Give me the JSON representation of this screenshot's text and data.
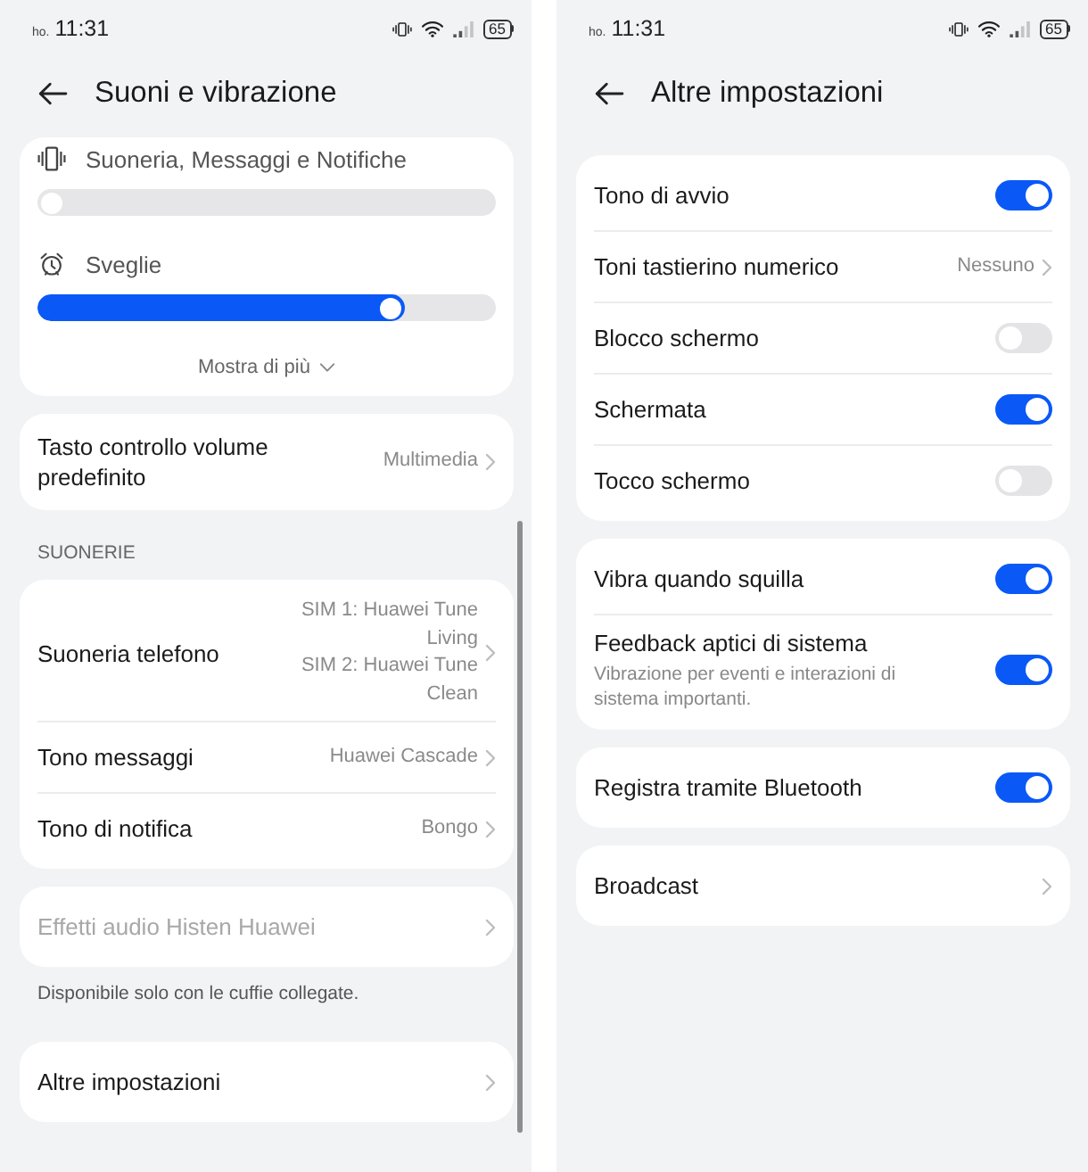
{
  "screens": [
    {
      "status_bar": {
        "carrier": "ho.",
        "time": "11:31",
        "battery": "65"
      },
      "title": "Suoni e vibrazione",
      "scrolled": true,
      "groups": [
        {
          "kind": "card",
          "rows": [
            {
              "kind": "slider",
              "label": "Suoneria, Messaggi e Notifiche",
              "level": 0
            },
            {
              "kind": "slider",
              "label": "Sveglie",
              "level": 0.8
            },
            {
              "kind": "more",
              "label": "Mostra di più"
            }
          ]
        },
        {
          "kind": "card",
          "rows": [
            {
              "kind": "nav",
              "label": "Tasto controllo volume predefinito",
              "values": [
                "Multimedia"
              ],
              "disabled": false
            }
          ]
        },
        {
          "kind": "header",
          "label": "SUONERIE"
        },
        {
          "kind": "card",
          "rows": [
            {
              "kind": "nav",
              "label": "Suoneria telefono",
              "values": [
                "SIM 1: Huawei Tune Living",
                "SIM 2: Huawei Tune Clean"
              ],
              "disabled": false
            },
            {
              "kind": "nav",
              "label": "Tono messaggi",
              "values": [
                "Huawei Cascade"
              ],
              "disabled": false
            },
            {
              "kind": "nav",
              "label": "Tono di notifica",
              "values": [
                "Bongo"
              ],
              "disabled": false
            }
          ]
        },
        {
          "kind": "card",
          "rows": [
            {
              "kind": "nav",
              "label": "Effetti audio Histen Huawei",
              "disabled": true
            }
          ]
        },
        {
          "kind": "note",
          "label": "Disponibile solo con le cuffie collegate."
        },
        {
          "kind": "card",
          "rows": [
            {
              "kind": "nav",
              "label": "Altre impostazioni",
              "disabled": false
            }
          ]
        }
      ]
    },
    {
      "status_bar": {
        "carrier": "ho.",
        "time": "11:31",
        "battery": "65"
      },
      "title": "Altre impostazioni",
      "scrolled": false,
      "groups": [
        {
          "kind": "card",
          "rows": [
            {
              "kind": "toggle",
              "label": "Tono di avvio",
              "on": true
            },
            {
              "kind": "nav",
              "label": "Toni tastierino numerico",
              "values": [
                "Nessuno"
              ],
              "disabled": false
            },
            {
              "kind": "toggle",
              "label": "Blocco schermo",
              "on": false
            },
            {
              "kind": "toggle",
              "label": "Schermata",
              "on": true
            },
            {
              "kind": "toggle",
              "label": "Tocco schermo",
              "on": false
            }
          ]
        },
        {
          "kind": "card",
          "rows": [
            {
              "kind": "toggle",
              "label": "Vibra quando squilla",
              "on": true
            },
            {
              "kind": "toggle",
              "label": "Feedback aptici di sistema",
              "description": "Vibrazione per eventi e interazioni di sistema importanti.",
              "on": true
            }
          ]
        },
        {
          "kind": "card",
          "rows": [
            {
              "kind": "toggle",
              "label": "Registra tramite Bluetooth",
              "on": true
            }
          ]
        },
        {
          "kind": "card",
          "rows": [
            {
              "kind": "nav",
              "label": "Broadcast",
              "disabled": false
            }
          ]
        }
      ]
    }
  ]
}
